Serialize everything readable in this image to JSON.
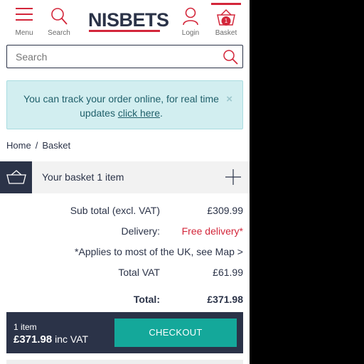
{
  "header": {
    "menu_label": "Menu",
    "search_label": "Search",
    "logo_text": "NISBETS",
    "login_label": "Login",
    "basket_label": "Basket",
    "basket_count": "1"
  },
  "search": {
    "placeholder": "Search"
  },
  "notice": {
    "text_before": "You can track your order online, for real time updates ",
    "link_text": "click here",
    "text_after": ".",
    "close_symbol": "×"
  },
  "breadcrumb": {
    "home": "Home",
    "separator": "/",
    "current": "Basket"
  },
  "basket_panel": {
    "title": "Your basket 1 item"
  },
  "summary": {
    "subtotal_label": "Sub total (excl. VAT)",
    "subtotal_value": "£309.99",
    "delivery_label": "Delivery:",
    "delivery_value": "Free delivery*",
    "delivery_note": "*Applies to most of the UK, see Map >",
    "vat_label": "Total VAT",
    "vat_value": "£61.99",
    "total_label": "Total:",
    "total_value": "£371.98"
  },
  "checkout": {
    "items": "1 item",
    "price": "£371.98",
    "price_suffix": "inc VAT",
    "button_label": "CHECKOUT"
  },
  "colors": {
    "navy": "#2b3348",
    "red": "#d3263a",
    "teal": "#14a89a",
    "notice_bg": "#d2eef0"
  }
}
